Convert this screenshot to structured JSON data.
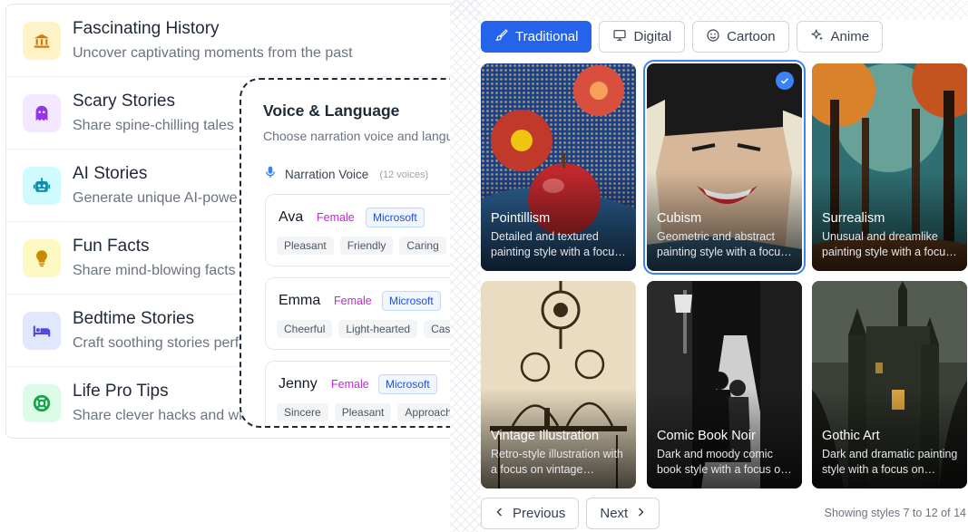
{
  "topics": [
    {
      "title": "Fascinating History",
      "desc": "Uncover captivating moments from the past",
      "icon": "bank-icon",
      "bg": "#fef3c7",
      "fg": "#d97706"
    },
    {
      "title": "Scary Stories",
      "desc": "Share spine-chilling tales",
      "icon": "ghost-icon",
      "bg": "#f3e8ff",
      "fg": "#9333ea"
    },
    {
      "title": "AI Stories",
      "desc": "Generate unique AI-powe",
      "icon": "robot-icon",
      "bg": "#cffafe",
      "fg": "#0891b2"
    },
    {
      "title": "Fun Facts",
      "desc": "Share mind-blowing facts",
      "icon": "lightbulb-icon",
      "bg": "#fef9c3",
      "fg": "#ca8a04"
    },
    {
      "title": "Bedtime Stories",
      "desc": "Craft soothing stories perf",
      "icon": "bed-icon",
      "bg": "#e0e7ff",
      "fg": "#4f46e5"
    },
    {
      "title": "Life Pro Tips",
      "desc": "Share clever hacks and wi",
      "icon": "lifebuoy-icon",
      "bg": "#dcfce7",
      "fg": "#16a34a"
    }
  ],
  "voice": {
    "title": "Voice & Language",
    "subtitle": "Choose narration voice and language p",
    "narration_label": "Narration Voice",
    "voice_count": "(12 voices)",
    "voices": [
      {
        "name": "Ava",
        "gender": "Female",
        "provider": "Microsoft",
        "tags": [
          "Pleasant",
          "Friendly",
          "Caring"
        ]
      },
      {
        "name": "Emma",
        "gender": "Female",
        "provider": "Microsoft",
        "tags": [
          "Cheerful",
          "Light-hearted",
          "Casual"
        ]
      },
      {
        "name": "Jenny",
        "gender": "Female",
        "provider": "Microsoft",
        "tags": [
          "Sincere",
          "Pleasant",
          "Approachable"
        ]
      }
    ]
  },
  "gallery": {
    "tabs": [
      {
        "label": "Traditional",
        "icon": "brush-icon",
        "active": true
      },
      {
        "label": "Digital",
        "icon": "monitor-icon",
        "active": false
      },
      {
        "label": "Cartoon",
        "icon": "smiley-icon",
        "active": false
      },
      {
        "label": "Anime",
        "icon": "sparkles-icon",
        "active": false
      }
    ],
    "styles": [
      {
        "name": "Pointillism",
        "desc": "Detailed and textured painting style with a focus on dots",
        "selected": false
      },
      {
        "name": "Cubism",
        "desc": "Geometric and abstract painting style with a focus on shapes",
        "selected": true
      },
      {
        "name": "Surrealism",
        "desc": "Unusual and dreamlike painting style with a focus on imagination",
        "selected": false
      },
      {
        "name": "Vintage Illustration",
        "desc": "Retro-style illustration with a focus on vintage aesthetics",
        "selected": false
      },
      {
        "name": "Comic Book Noir",
        "desc": "Dark and moody comic book style with a focus on shadows",
        "selected": false
      },
      {
        "name": "Gothic Art",
        "desc": "Dark and dramatic painting style with a focus on architecture",
        "selected": false
      }
    ],
    "prev_label": "Previous",
    "next_label": "Next",
    "showing": "Showing styles 7 to 12 of 14",
    "accent": "#2563eb"
  }
}
